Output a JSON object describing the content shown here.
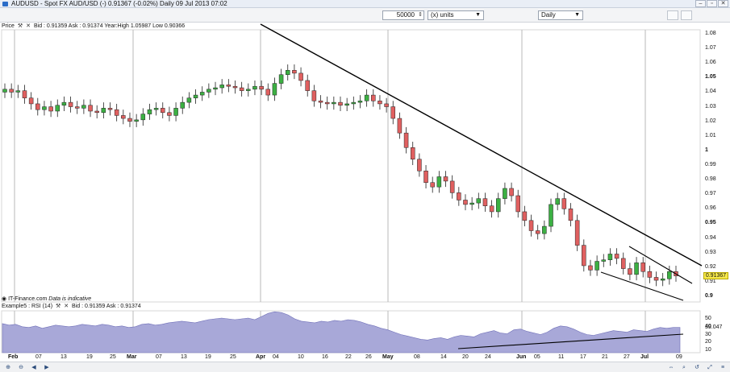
{
  "window": {
    "title": "AUDUSD - Spot FX AUD/USD (-)     0.91367 (-0.02%)     Daily  09 Jul 2013 07:02",
    "controls": [
      "–",
      "▫",
      "✕"
    ]
  },
  "toolbar": {
    "quantity_value": "50000",
    "units_value": "(x) units",
    "period_value": "Daily"
  },
  "price_pane": {
    "label": "Price",
    "info": "Bid : 0.91359 Ask : 0.91374 Year:High 1.05987 Low 0.90366",
    "last_price": "0.91367",
    "source_note": "IT-Finance.com",
    "disclaimer": "Data is indicative"
  },
  "rsi_pane": {
    "label": "Example5 : RSI (14)",
    "info": "Bid : 0.91359 Ask : 0.91374",
    "current_value": "39.047"
  },
  "price_axis": [
    {
      "text": "1.08",
      "bold": false
    },
    {
      "text": "1.07",
      "bold": false
    },
    {
      "text": "1.06",
      "bold": false
    },
    {
      "text": "1.05",
      "bold": true
    },
    {
      "text": "1.04",
      "bold": false
    },
    {
      "text": "1.03",
      "bold": false
    },
    {
      "text": "1.02",
      "bold": false
    },
    {
      "text": "1.01",
      "bold": false
    },
    {
      "text": "1",
      "bold": true
    },
    {
      "text": "0.99",
      "bold": false
    },
    {
      "text": "0.98",
      "bold": false
    },
    {
      "text": "0.97",
      "bold": false
    },
    {
      "text": "0.96",
      "bold": false
    },
    {
      "text": "0.95",
      "bold": true
    },
    {
      "text": "0.94",
      "bold": false
    },
    {
      "text": "0.93",
      "bold": false
    },
    {
      "text": "0.92",
      "bold": false
    },
    {
      "text": "0.91",
      "bold": false
    },
    {
      "text": "0.9",
      "bold": true
    }
  ],
  "rsi_axis": [
    "50",
    "40",
    "30",
    "20",
    "10"
  ],
  "date_axis": [
    {
      "text": "Feb",
      "bold": true
    },
    {
      "text": "07",
      "bold": false
    },
    {
      "text": "13",
      "bold": false
    },
    {
      "text": "19",
      "bold": false
    },
    {
      "text": "25",
      "bold": false
    },
    {
      "text": "Mar",
      "bold": true
    },
    {
      "text": "07",
      "bold": false
    },
    {
      "text": "13",
      "bold": false
    },
    {
      "text": "19",
      "bold": false
    },
    {
      "text": "25",
      "bold": false
    },
    {
      "text": "Apr",
      "bold": true
    },
    {
      "text": "04",
      "bold": false
    },
    {
      "text": "10",
      "bold": false
    },
    {
      "text": "16",
      "bold": false
    },
    {
      "text": "22",
      "bold": false
    },
    {
      "text": "26",
      "bold": false
    },
    {
      "text": "May",
      "bold": true
    },
    {
      "text": "08",
      "bold": false
    },
    {
      "text": "14",
      "bold": false
    },
    {
      "text": "20",
      "bold": false
    },
    {
      "text": "24",
      "bold": false
    },
    {
      "text": "Jun",
      "bold": true
    },
    {
      "text": "05",
      "bold": false
    },
    {
      "text": "11",
      "bold": false
    },
    {
      "text": "17",
      "bold": false
    },
    {
      "text": "21",
      "bold": false
    },
    {
      "text": "27",
      "bold": false
    },
    {
      "text": "Jul",
      "bold": true
    },
    {
      "text": "09",
      "bold": false
    }
  ],
  "colors": {
    "bull": "#3cb043",
    "bear": "#e06060",
    "rsi_fill": "#a8a8d8",
    "trendline": "#000000"
  },
  "chart_data": [
    {
      "type": "candlestick",
      "title": "AUDUSD - Spot FX AUD/USD (-)",
      "x_range": [
        "2013-02-01",
        "2013-07-09"
      ],
      "ylim": [
        0.9,
        1.08
      ],
      "grid": false,
      "closes": [
        1.042,
        1.04,
        1.041,
        1.036,
        1.032,
        1.028,
        1.03,
        1.027,
        1.031,
        1.033,
        1.03,
        1.029,
        1.031,
        1.027,
        1.026,
        1.029,
        1.028,
        1.024,
        1.022,
        1.02,
        1.021,
        1.025,
        1.028,
        1.029,
        1.026,
        1.024,
        1.029,
        1.033,
        1.036,
        1.038,
        1.04,
        1.042,
        1.043,
        1.045,
        1.044,
        1.043,
        1.041,
        1.042,
        1.044,
        1.042,
        1.038,
        1.046,
        1.052,
        1.055,
        1.053,
        1.048,
        1.041,
        1.034,
        1.033,
        1.032,
        1.033,
        1.031,
        1.032,
        1.033,
        1.034,
        1.038,
        1.034,
        1.032,
        1.03,
        1.022,
        1.012,
        1.002,
        0.994,
        0.986,
        0.978,
        0.975,
        0.982,
        0.979,
        0.971,
        0.966,
        0.963,
        0.964,
        0.967,
        0.962,
        0.958,
        0.967,
        0.974,
        0.969,
        0.958,
        0.952,
        0.945,
        0.943,
        0.948,
        0.963,
        0.967,
        0.96,
        0.952,
        0.935,
        0.921,
        0.918,
        0.924,
        0.925,
        0.929,
        0.926,
        0.919,
        0.915,
        0.923,
        0.917,
        0.913,
        0.911,
        0.912,
        0.917,
        0.914
      ]
    },
    {
      "type": "area",
      "title": "Example5 : RSI (14)",
      "ylim": [
        10,
        60
      ],
      "values": [
        44,
        42,
        43,
        40,
        39,
        41,
        38,
        40,
        42,
        41,
        40,
        41,
        43,
        42,
        41,
        43,
        42,
        40,
        41,
        39,
        40,
        43,
        44,
        42,
        43,
        45,
        46,
        47,
        46,
        45,
        47,
        49,
        50,
        51,
        50,
        49,
        50,
        51,
        49,
        53,
        57,
        59,
        58,
        55,
        50,
        47,
        46,
        45,
        47,
        46,
        48,
        47,
        49,
        48,
        46,
        43,
        41,
        38,
        36,
        33,
        30,
        28,
        26,
        24,
        23,
        25,
        26,
        24,
        27,
        29,
        28,
        27,
        31,
        33,
        35,
        32,
        31,
        36,
        37,
        34,
        32,
        30,
        33,
        38,
        41,
        40,
        37,
        33,
        30,
        29,
        31,
        33,
        35,
        34,
        33,
        36,
        35,
        34,
        37,
        39,
        38,
        39,
        39
      ]
    }
  ]
}
